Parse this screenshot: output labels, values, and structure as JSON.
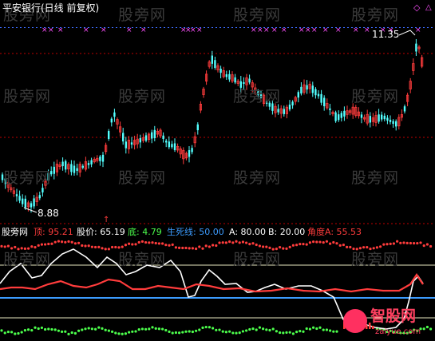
{
  "chart_title": "平安银行(日线 前复权)",
  "watermark": "股旁网",
  "price_high_label": "11.35",
  "price_low_label": "8.88",
  "indicator": {
    "name": "股旁网",
    "top_label": "顶:",
    "top_value": "95.21",
    "price_label": "股价:",
    "price_value": "65.19",
    "bottom_label": "底:",
    "bottom_value": "4.79",
    "lifeline_label": "生死线:",
    "lifeline_value": "50.00",
    "a_label": "A:",
    "a_value": "80.00",
    "b_label": "B:",
    "b_value": "20.00",
    "angle_label": "角度A:",
    "angle_value": "55.53"
  },
  "corner_icons": [
    "diamond-icon",
    "triangle-icon"
  ],
  "logo": {
    "name": "智股网",
    "url": "zaiyue.com"
  },
  "colors": {
    "up": "#ff3c3c",
    "down": "#53ffff",
    "magenta": "#ff50ff",
    "white": "#ffffff",
    "green": "#4cff4c",
    "blue": "#3c9cff",
    "yellow": "#ffff50",
    "grid": "#c00000"
  },
  "chart_data": {
    "type": "candlestick",
    "price_range": [
      8.6,
      11.6
    ],
    "labels": {
      "high": 11.35,
      "low": 8.88
    },
    "indicator_lines": {
      "top": 95.21,
      "price": 65.19,
      "bottom": 4.79,
      "lifeline": 50.0,
      "A": 80.0,
      "B": 20.0,
      "angle_A": 55.53
    }
  }
}
